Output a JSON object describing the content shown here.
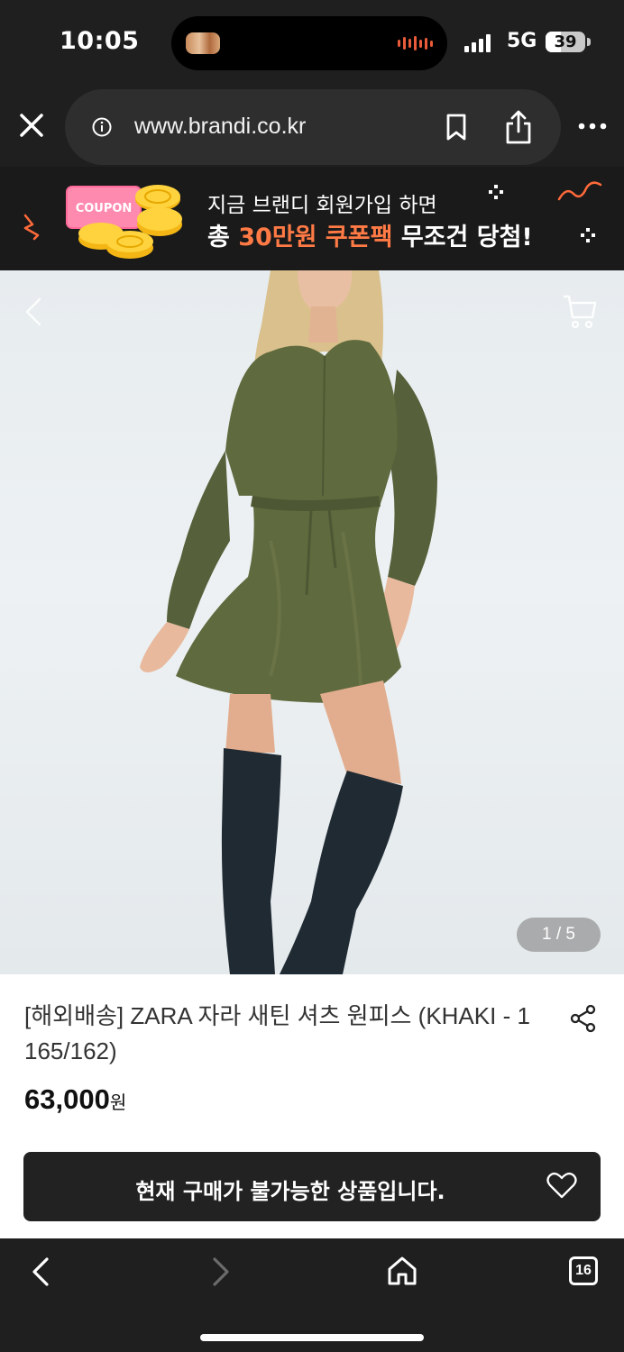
{
  "status_bar": {
    "time": "10:05",
    "network": "5G",
    "battery": "39",
    "battery_level": 0.39
  },
  "browser": {
    "url": "www.brandi.co.kr"
  },
  "banner": {
    "coupon_label": "COUPON",
    "line1": "지금 브랜디 회원가입 하면",
    "line2_a": "총 ",
    "line2_highlight": "30만원 쿠폰팩",
    "line2_b": " 무조건 당첨!"
  },
  "gallery": {
    "counter": "1 / 5"
  },
  "product": {
    "title": "[해외배송] ZARA 자라 새틴 셔츠 원피스 (KHAKI - 1 165/162)",
    "price": "63,000",
    "price_unit": "원",
    "buy_status": "현재 구매가 불가능한 상품입니다."
  },
  "toolbar": {
    "tab_count": "16"
  },
  "colors": {
    "accent": "#ff7a45",
    "dark_bar": "#222222",
    "dress": "#5f6a3e"
  }
}
